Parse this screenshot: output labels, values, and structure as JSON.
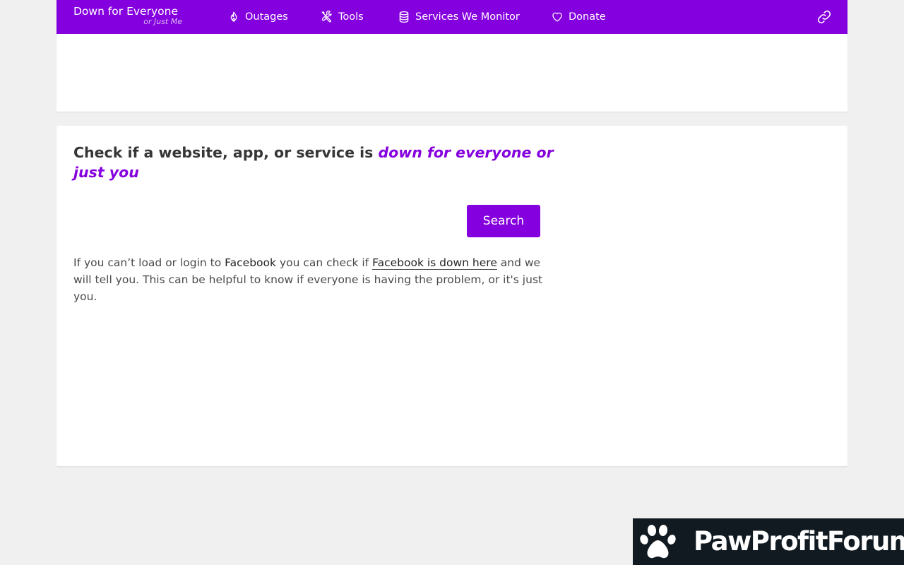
{
  "nav": {
    "brand_title": "Down for Everyone",
    "brand_subtitle": "or Just Me",
    "items": [
      {
        "label": "Outages",
        "icon": "flame-icon"
      },
      {
        "label": "Tools",
        "icon": "tools-icon"
      },
      {
        "label": "Services We Monitor",
        "icon": "database-icon"
      },
      {
        "label": "Donate",
        "icon": "heart-icon"
      }
    ],
    "link_icon": "link-icon"
  },
  "main": {
    "heading_prefix": "Check if a website, app, or service is ",
    "heading_accent": "down for everyone or just you",
    "search": {
      "value": "",
      "placeholder": "",
      "button_label": "Search"
    },
    "description": {
      "part1": "If you can’t load or login to ",
      "link1": "Facebook",
      "part2": " you can check if ",
      "link2": "Facebook is down here",
      "part3": " and we will tell you. This can be helpful to know if everyone is having the problem, or it's just you."
    }
  },
  "banner": {
    "text": "PawProfitForum",
    "icon": "paw-icon"
  },
  "colors": {
    "brand": "#8500de",
    "background": "#f0f0f0",
    "banner_bg": "#101a20"
  }
}
